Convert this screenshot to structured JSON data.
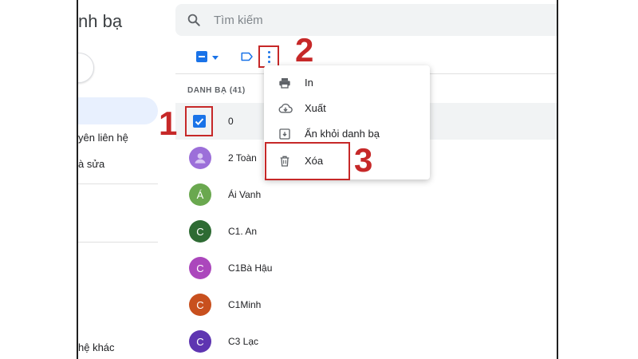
{
  "sidebar": {
    "title": "nh bạ",
    "items": [
      {
        "label": "yên liên hệ"
      },
      {
        "label": "à sửa"
      },
      {
        "label": "hệ khác"
      }
    ]
  },
  "search": {
    "placeholder": "Tìm kiếm"
  },
  "list": {
    "header": "DANH BẠ (41)",
    "rows": [
      {
        "name": "0",
        "selected": true
      },
      {
        "name": "2 Toàn",
        "initial": "",
        "color": "#9c6fd9"
      },
      {
        "name": "Ái Vanh",
        "initial": "Á",
        "color": "#6aa84f"
      },
      {
        "name": "C1. An",
        "initial": "C",
        "color": "#2e6b33"
      },
      {
        "name": "C1Bà Hậu",
        "initial": "C",
        "color": "#ab47bc"
      },
      {
        "name": "C1Minh",
        "initial": "C",
        "color": "#c8501e"
      },
      {
        "name": "C3 Lạc",
        "initial": "C",
        "color": "#5e35b1"
      }
    ]
  },
  "menu": {
    "items": [
      {
        "label": "In",
        "icon": "printer-icon"
      },
      {
        "label": "Xuất",
        "icon": "cloud-download-icon"
      },
      {
        "label": "Ẩn khỏi danh bạ",
        "icon": "archive-icon"
      },
      {
        "label": "Xóa",
        "icon": "trash-icon"
      }
    ]
  },
  "steps": [
    "1",
    "2",
    "3"
  ],
  "colors": {
    "accent": "#1a73e8",
    "annotation": "#c62828",
    "selected_row": "#f1f3f4",
    "sidebar_active": "#e8f0fe"
  }
}
